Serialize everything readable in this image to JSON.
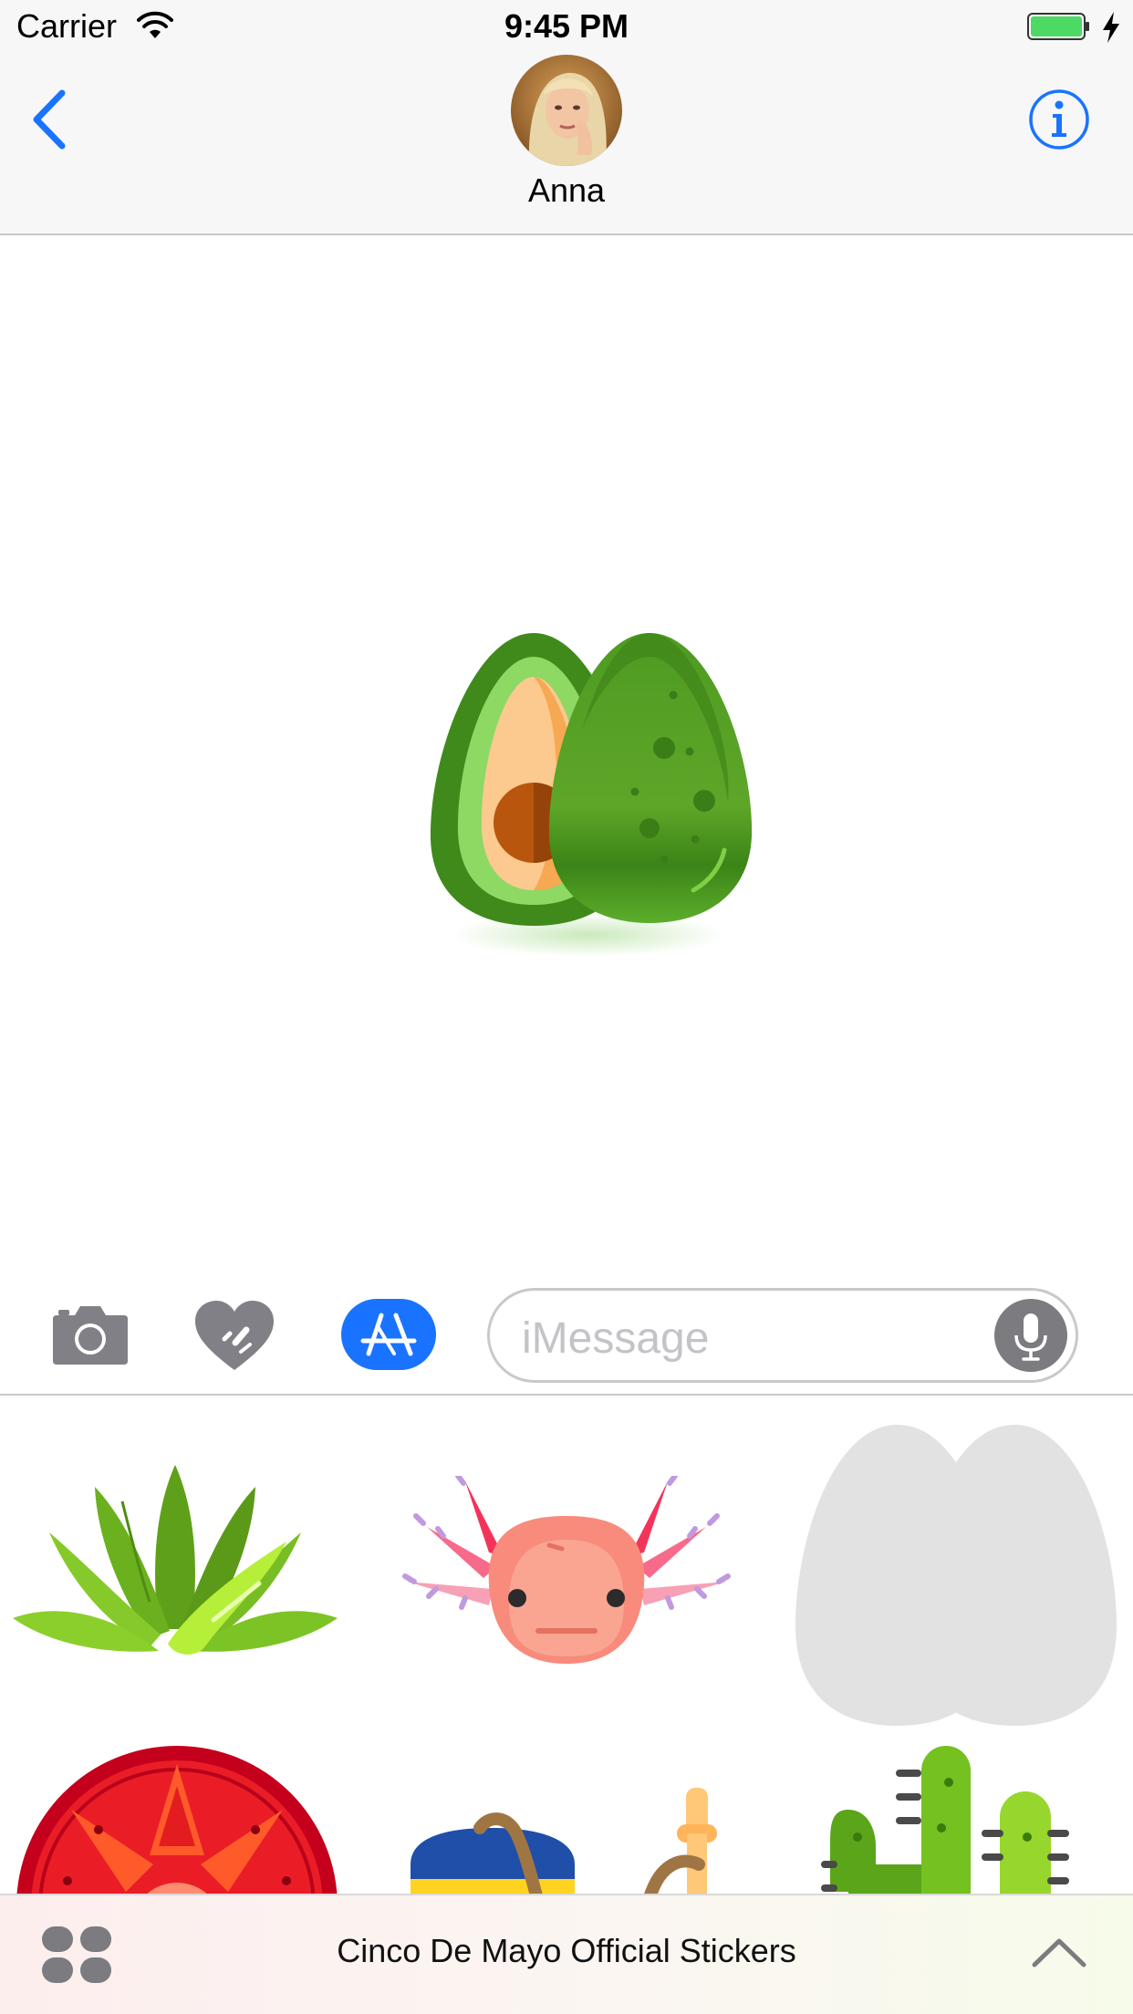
{
  "status_bar": {
    "carrier": "Carrier",
    "time": "9:45 PM",
    "wifi_icon": "wifi-icon",
    "battery_icon": "battery-charging-icon"
  },
  "header": {
    "contact_name": "Anna",
    "back_icon": "chevron-left-icon",
    "info_icon": "info-icon"
  },
  "conversation": {
    "sent_sticker": "avocado-sticker"
  },
  "composer": {
    "placeholder": "iMessage",
    "icons": [
      "camera-icon",
      "digital-touch-icon",
      "app-store-icon",
      "microphone-icon"
    ]
  },
  "sticker_tray": {
    "stickers": [
      "agave-sticker",
      "axolotl-sticker",
      "loading-placeholder-sticker",
      "sun-calendar-sticker",
      "sombrero-guitar-sticker",
      "cactus-sticker"
    ]
  },
  "app_drawer": {
    "title": "Cinco De Mayo Official Stickers"
  },
  "colors": {
    "accent": "#1a73ff",
    "bar_background": "#f7f7f7",
    "placeholder_text": "#c3c3c8"
  }
}
